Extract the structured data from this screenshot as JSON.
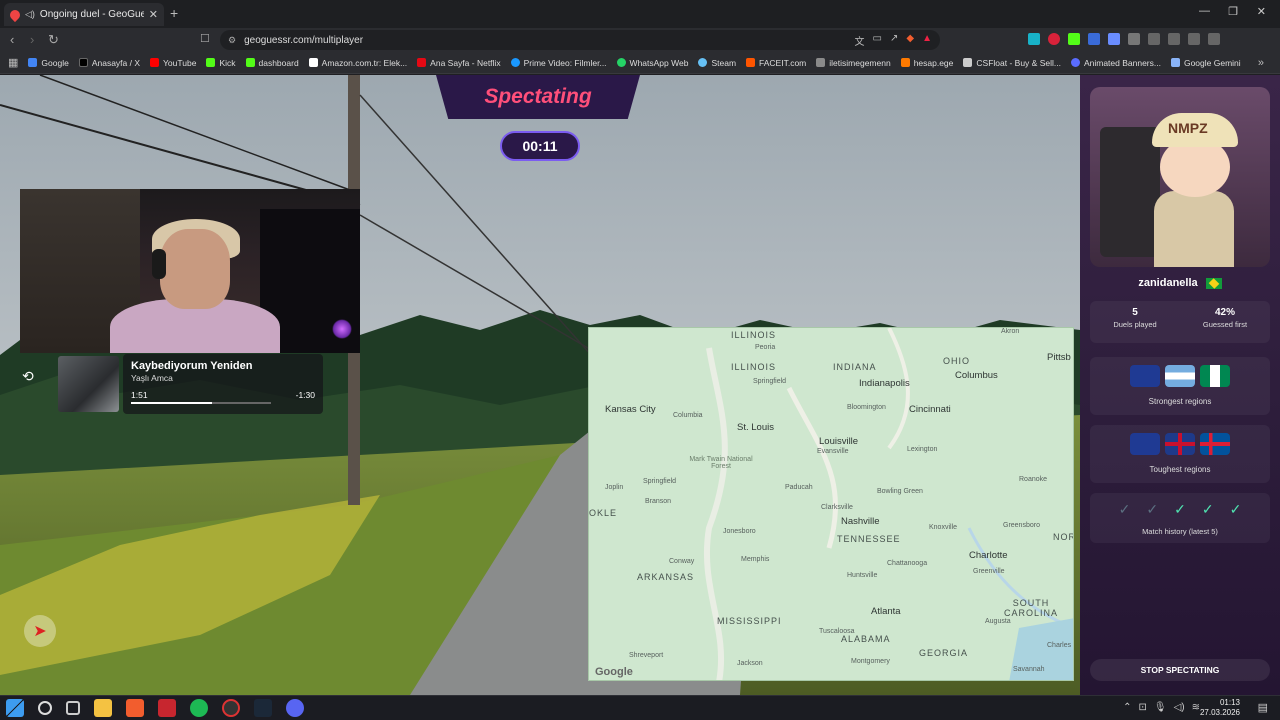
{
  "browser": {
    "tab_title": "Ongoing duel - GeoGuessr",
    "url": "geoguessr.com/multiplayer",
    "bookmarks": [
      {
        "label": "Google",
        "color": "#4285f4"
      },
      {
        "label": "Anasayfa / X",
        "color": "#000000"
      },
      {
        "label": "YouTube",
        "color": "#ff0000"
      },
      {
        "label": "Kick",
        "color": "#53fc18"
      },
      {
        "label": "dashboard",
        "color": "#53fc18"
      },
      {
        "label": "Amazon.com.tr: Elek...",
        "color": "#ffffff"
      },
      {
        "label": "Ana Sayfa - Netflix",
        "color": "#e50914"
      },
      {
        "label": "Prime Video: Filmler...",
        "color": "#1a98ff"
      },
      {
        "label": "WhatsApp Web",
        "color": "#25d366"
      },
      {
        "label": "Steam",
        "color": "#66c0f4"
      },
      {
        "label": "FACEIT.com",
        "color": "#ff5500"
      },
      {
        "label": "iletisimegemenn",
        "color": "#8a8a8a"
      },
      {
        "label": "hesap.ege",
        "color": "#ff7a00"
      },
      {
        "label": "CSFloat - Buy & Sell...",
        "color": "#cccccc"
      },
      {
        "label": "Animated Banners...",
        "color": "#5a6cff"
      },
      {
        "label": "Google Gemini",
        "color": "#8ab4f8"
      }
    ]
  },
  "game": {
    "spectating_label": "Spectating",
    "timer": "00:11",
    "compass_icon": "compass-icon"
  },
  "music": {
    "song": "Kaybediyorum Yeniden",
    "artist": "Yaşlı Amca",
    "elapsed": "1:51",
    "remaining": "-1:30",
    "progress": 0.58
  },
  "map": {
    "states": [
      "ILLINOIS",
      "INDIANA",
      "OHIO",
      "TENNESSEE",
      "ARKANSAS",
      "MISSISSIPPI",
      "ALABAMA",
      "GEORGIA",
      "SOUTH CAROLINA",
      "NOR CARO",
      "OKLE"
    ],
    "cities_big": [
      "Kansas City",
      "St. Louis",
      "Indianapolis",
      "Cincinnati",
      "Columbus",
      "Louisville",
      "Nashville",
      "Charlotte",
      "Atlanta",
      "Pittsb"
    ],
    "cities_small": [
      "Peoria",
      "Springfield",
      "Columbia",
      "Springfield",
      "Bloomington",
      "Lexington",
      "Evansville",
      "Joplin",
      "Branson",
      "Paducah",
      "Bowling Green",
      "Clarksville",
      "Knoxville",
      "Jonesboro",
      "Memphis",
      "Conway",
      "Chattanooga",
      "Huntsville",
      "Greenville",
      "Greensboro",
      "Roanoke",
      "Tuscaloosa",
      "Montgomery",
      "Augusta",
      "Shreveport",
      "Jackson",
      "Savannah",
      "Charles",
      "Akron"
    ],
    "park_label": "Mark Twain National Forest",
    "attribution": "Google"
  },
  "player": {
    "name": "zanidanella",
    "avatar_badge": "NMPZ",
    "duels_played": "5",
    "duels_played_label": "Duels played",
    "guessed_first": "42%",
    "guessed_first_label": "Guessed first",
    "strongest_label": "Strongest regions",
    "toughest_label": "Toughest regions",
    "history_label": "Match history (latest 5)",
    "history": [
      "loss",
      "loss",
      "win",
      "win",
      "win"
    ]
  },
  "actions": {
    "stop_label": "STOP SPECTATING"
  },
  "taskbar": {
    "time": "01:13",
    "date": "27.03.2026"
  }
}
